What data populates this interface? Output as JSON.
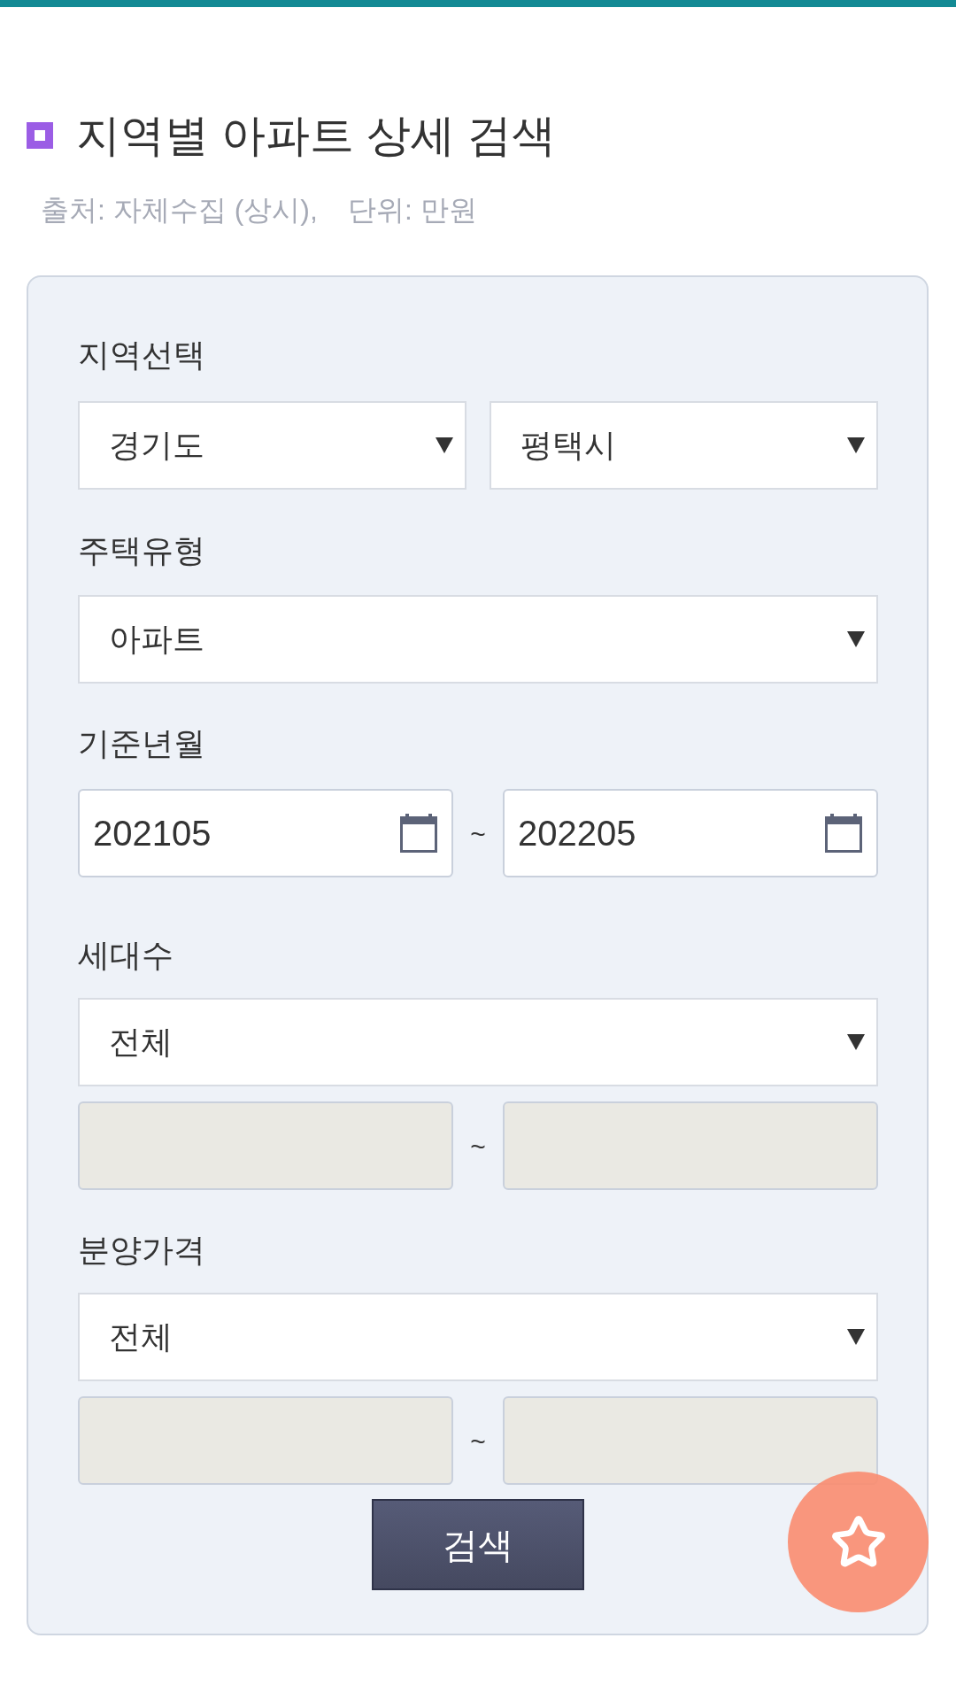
{
  "heading": {
    "title": "지역별 아파트 상세 검색"
  },
  "note": {
    "source": "출처: 자체수집 (상시),",
    "unit": "단위: 만원"
  },
  "form": {
    "fields": [
      {
        "kind": "select_pair",
        "label": "지역선택",
        "selects": [
          {
            "value": "경기도"
          },
          {
            "value": "평택시"
          }
        ]
      },
      {
        "kind": "select",
        "label": "주택유형",
        "select": {
          "value": "아파트"
        }
      },
      {
        "kind": "date_range",
        "label": "기준년월",
        "from": {
          "value": "202105"
        },
        "separator": "~",
        "to": {
          "value": "202205"
        }
      },
      {
        "kind": "select_range",
        "label": "세대수",
        "select": {
          "value": "전체"
        },
        "from": {
          "disabled": true
        },
        "separator": "~",
        "to": {
          "disabled": true
        }
      },
      {
        "kind": "select_range",
        "label": "분양가격",
        "select": {
          "value": "전체"
        },
        "from": {
          "disabled": true
        },
        "separator": "~",
        "to": {
          "disabled": true
        }
      }
    ],
    "search_button": {
      "label": "검색"
    }
  }
}
